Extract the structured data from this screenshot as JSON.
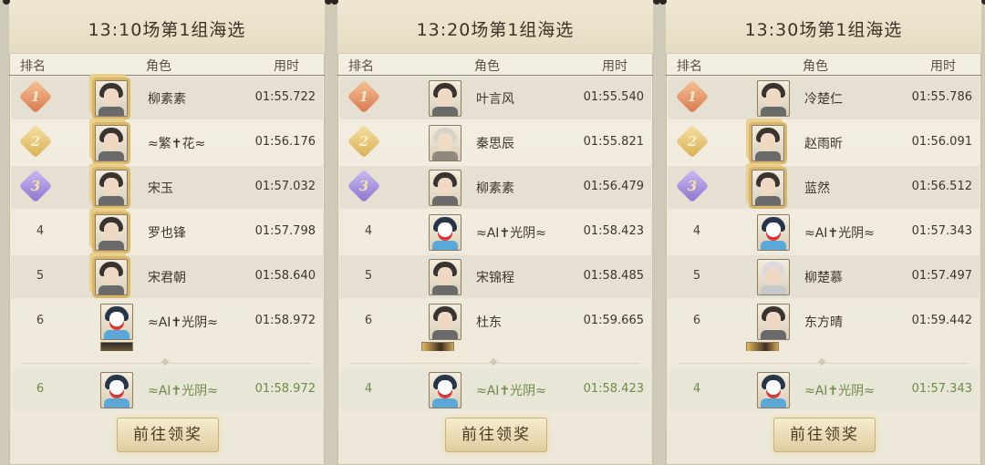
{
  "column_headers": {
    "rank": "排名",
    "role": "角色",
    "time": "用时"
  },
  "claim_button_label": "前往领奖",
  "panels": [
    {
      "title": "13:10场第1组海选",
      "rows": [
        {
          "rank": "1",
          "name": "柳素素",
          "time": "01:55.722",
          "avatar": "female-portrait-icon"
        },
        {
          "rank": "2",
          "name": "≈繁✝花≈",
          "time": "01:56.176",
          "avatar": "female-portrait-icon"
        },
        {
          "rank": "3",
          "name": "宋玉",
          "time": "01:57.032",
          "avatar": "female-portrait-icon"
        },
        {
          "rank": "4",
          "name": "罗也锋",
          "time": "01:57.798",
          "avatar": "male-portrait-icon"
        },
        {
          "rank": "5",
          "name": "宋君朝",
          "time": "01:58.640",
          "avatar": "male-portrait-icon"
        },
        {
          "rank": "6",
          "name": "≈AI✝光阴≈",
          "time": "01:58.972",
          "avatar": "opera-mask-portrait-icon"
        }
      ],
      "my_row": {
        "rank": "6",
        "name": "≈AI✝光阴≈",
        "time": "01:58.972",
        "avatar": "opera-mask-portrait-icon"
      }
    },
    {
      "title": "13:20场第1组海选",
      "rows": [
        {
          "rank": "1",
          "name": "叶言风",
          "time": "01:55.540",
          "avatar": "male-portrait-icon"
        },
        {
          "rank": "2",
          "name": "秦思辰",
          "time": "01:55.821",
          "avatar": "elder-portrait-icon"
        },
        {
          "rank": "3",
          "name": "柳素素",
          "time": "01:56.479",
          "avatar": "female-portrait-icon"
        },
        {
          "rank": "4",
          "name": "≈AI✝光阴≈",
          "time": "01:58.423",
          "avatar": "opera-mask-portrait-icon"
        },
        {
          "rank": "5",
          "name": "宋锦程",
          "time": "01:58.485",
          "avatar": "male-portrait-icon"
        },
        {
          "rank": "6",
          "name": "杜东",
          "time": "01:59.665",
          "avatar": "male-portrait-icon"
        }
      ],
      "my_row": {
        "rank": "4",
        "name": "≈AI✝光阴≈",
        "time": "01:58.423",
        "avatar": "opera-mask-portrait-icon"
      }
    },
    {
      "title": "13:30场第1组海选",
      "rows": [
        {
          "rank": "1",
          "name": "冷楚仁",
          "time": "01:55.786",
          "avatar": "female-portrait-icon"
        },
        {
          "rank": "2",
          "name": "赵雨昕",
          "time": "01:56.091",
          "avatar": "female-portrait-icon"
        },
        {
          "rank": "3",
          "name": "蓝然",
          "time": "01:56.512",
          "avatar": "male-portrait-icon"
        },
        {
          "rank": "4",
          "name": "≈AI✝光阴≈",
          "time": "01:57.343",
          "avatar": "opera-mask-portrait-icon"
        },
        {
          "rank": "5",
          "name": "柳楚慕",
          "time": "01:57.497",
          "avatar": "white-hair-portrait-icon"
        },
        {
          "rank": "6",
          "name": "东方晴",
          "time": "01:59.442",
          "avatar": "female-portrait-icon"
        }
      ],
      "my_row": {
        "rank": "4",
        "name": "≈AI✝光阴≈",
        "time": "01:57.343",
        "avatar": "opera-mask-portrait-icon"
      }
    }
  ],
  "colors": {
    "gold_medal": "#d7774b",
    "silver_medal": "#d9ae52",
    "bronze_medal": "#8b74cf",
    "my_row_text": "#6e8a4a"
  }
}
